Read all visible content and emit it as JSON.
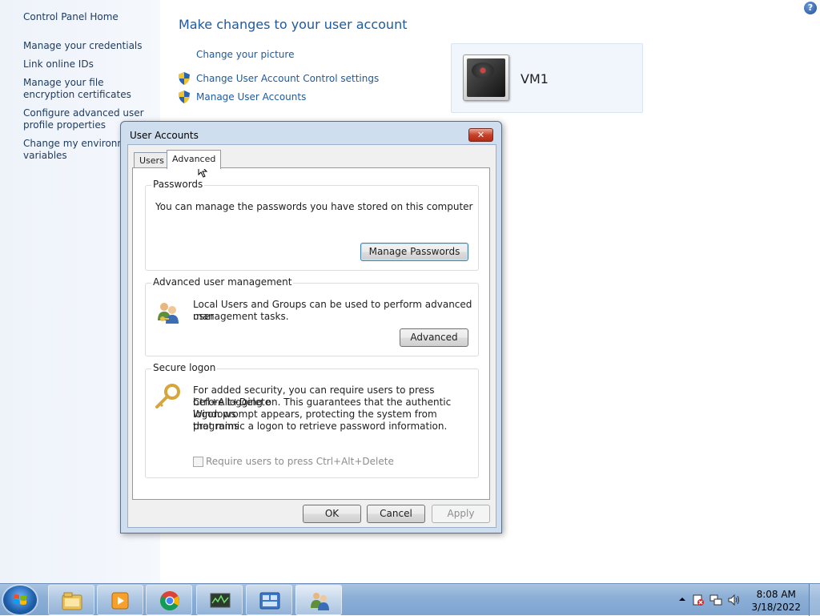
{
  "sidebar": {
    "home": "Control Panel Home",
    "items": [
      "Manage your credentials",
      "Link online IDs",
      "Manage your file encryption certificates",
      "Configure advanced user profile properties",
      "Change my environment variables"
    ]
  },
  "main": {
    "heading": "Make changes to your user account",
    "links": {
      "change_picture": "Change your picture",
      "uac_settings": "Change User Account Control settings",
      "manage_accounts": "Manage User Accounts"
    },
    "user_name": "VM1",
    "help_glyph": "?"
  },
  "dialog": {
    "title": "User Accounts",
    "close_glyph": "✕",
    "tabs": [
      "Users",
      "Advanced"
    ],
    "active_tab": "Advanced",
    "passwords": {
      "title": "Passwords",
      "text": "You can manage the passwords you have stored on this computer",
      "button": "Manage Passwords"
    },
    "advanced_mgmt": {
      "title": "Advanced user management",
      "text_line1": "Local Users and Groups can be used to perform advanced user",
      "text_line2": "management tasks.",
      "button": "Advanced"
    },
    "secure_logon": {
      "title": "Secure logon",
      "text_lines": [
        "For added security, you can require users to press Ctrl+Alt+Delete",
        "before logging on. This guarantees that the authentic Windows",
        "logon prompt appears, protecting the system from programs",
        "that mimic a logon to retrieve password information."
      ],
      "checkbox_label": "Require users to press Ctrl+Alt+Delete",
      "checkbox_checked": false
    },
    "buttons": {
      "ok": "OK",
      "cancel": "Cancel",
      "apply": "Apply"
    }
  },
  "taskbar": {
    "items": [
      "file-explorer-icon",
      "media-player-icon",
      "chrome-icon",
      "network-monitor-icon",
      "control-panel-icon",
      "user-accounts-icon"
    ],
    "clock_time": "8:08 AM",
    "clock_date": "3/18/2022"
  },
  "colors": {
    "link": "#1e5aa0",
    "dialog_frame": "#cfdeef",
    "taskbar": "#8aaed6"
  }
}
